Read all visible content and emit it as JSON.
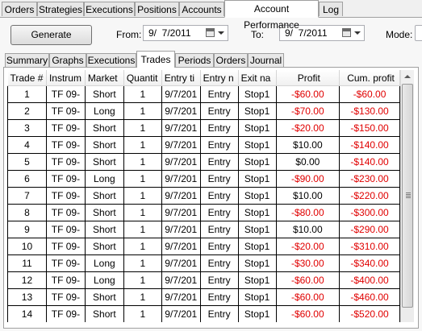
{
  "top_tabs": [
    "Orders",
    "Strategies",
    "Executions",
    "Positions",
    "Accounts",
    "Account Performance",
    "Log"
  ],
  "toolbar": {
    "generate_label": "Generate",
    "from_label": "From:",
    "from_value": "9/  7/2011",
    "to_label": "To:",
    "to_value": "9/  7/2011",
    "mode_label": "Mode:"
  },
  "inner_tabs": [
    "Summary",
    "Graphs",
    "Executions",
    "Trades",
    "Periods",
    "Orders",
    "Journal"
  ],
  "columns": [
    "Trade #",
    "Instrum",
    "Market",
    "Quantit",
    "Entry ti",
    "Entry n",
    "Exit na",
    "Profit",
    "Cum. profit"
  ],
  "rows": [
    [
      "1",
      "TF 09-",
      "Short",
      "1",
      "9/7/201",
      "Entry",
      "Stop1",
      "-$60.00",
      "-$60.00"
    ],
    [
      "2",
      "TF 09-",
      "Long",
      "1",
      "9/7/201",
      "Entry",
      "Stop1",
      "-$70.00",
      "-$130.00"
    ],
    [
      "3",
      "TF 09-",
      "Short",
      "1",
      "9/7/201",
      "Entry",
      "Stop1",
      "-$20.00",
      "-$150.00"
    ],
    [
      "4",
      "TF 09-",
      "Short",
      "1",
      "9/7/201",
      "Entry",
      "Stop1",
      "$10.00",
      "-$140.00"
    ],
    [
      "5",
      "TF 09-",
      "Short",
      "1",
      "9/7/201",
      "Entry",
      "Stop1",
      "$0.00",
      "-$140.00"
    ],
    [
      "6",
      "TF 09-",
      "Long",
      "1",
      "9/7/201",
      "Entry",
      "Stop1",
      "-$90.00",
      "-$230.00"
    ],
    [
      "7",
      "TF 09-",
      "Short",
      "1",
      "9/7/201",
      "Entry",
      "Stop1",
      "$10.00",
      "-$220.00"
    ],
    [
      "8",
      "TF 09-",
      "Short",
      "1",
      "9/7/201",
      "Entry",
      "Stop1",
      "-$80.00",
      "-$300.00"
    ],
    [
      "9",
      "TF 09-",
      "Short",
      "1",
      "9/7/201",
      "Entry",
      "Stop1",
      "$10.00",
      "-$290.00"
    ],
    [
      "10",
      "TF 09-",
      "Short",
      "1",
      "9/7/201",
      "Entry",
      "Stop1",
      "-$20.00",
      "-$310.00"
    ],
    [
      "11",
      "TF 09-",
      "Long",
      "1",
      "9/7/201",
      "Entry",
      "Stop1",
      "-$30.00",
      "-$340.00"
    ],
    [
      "12",
      "TF 09-",
      "Long",
      "1",
      "9/7/201",
      "Entry",
      "Stop1",
      "-$60.00",
      "-$400.00"
    ],
    [
      "13",
      "TF 09-",
      "Short",
      "1",
      "9/7/201",
      "Entry",
      "Stop1",
      "-$60.00",
      "-$460.00"
    ],
    [
      "14",
      "TF 09-",
      "Short",
      "1",
      "9/7/201",
      "Entry",
      "Stop1",
      "-$60.00",
      "-$520.00"
    ]
  ],
  "colors": {
    "negative": "#e00000",
    "positive": "#000000"
  }
}
